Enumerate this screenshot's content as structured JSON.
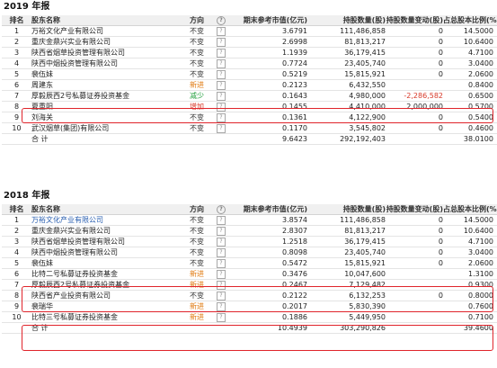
{
  "headers": {
    "rank": "排名",
    "name": "股东名称",
    "direction": "方向",
    "help_icon": "?",
    "market_value": "期末参考市值(亿元)",
    "holding": "持股数量(股)",
    "holding_change": "持股数量变动(股)",
    "pct": "占总股本比例(%)"
  },
  "report_2019": {
    "title": "2019 年报",
    "rows": [
      {
        "rank": "1",
        "name": "万裕文化产业有限公司",
        "dir": "不变",
        "dir_type": "same",
        "mv": "3.6791",
        "hold": "111,486,858",
        "chg": "0",
        "pct": "14.5000"
      },
      {
        "rank": "2",
        "name": "重庆金鼎兴实业有限公司",
        "dir": "不变",
        "dir_type": "same",
        "mv": "2.6998",
        "hold": "81,813,217",
        "chg": "0",
        "pct": "10.6400"
      },
      {
        "rank": "3",
        "name": "陕西省烟草投资管理有限公司",
        "dir": "不变",
        "dir_type": "same",
        "mv": "1.1939",
        "hold": "36,179,415",
        "chg": "0",
        "pct": "4.7100"
      },
      {
        "rank": "4",
        "name": "陕西中烟投资管理有限公司",
        "dir": "不变",
        "dir_type": "same",
        "mv": "0.7724",
        "hold": "23,405,740",
        "chg": "0",
        "pct": "3.0400"
      },
      {
        "rank": "5",
        "name": "裴伍妹",
        "dir": "不变",
        "dir_type": "same",
        "mv": "0.5219",
        "hold": "15,815,921",
        "chg": "0",
        "pct": "2.0600"
      },
      {
        "rank": "6",
        "name": "周建东",
        "dir": "新进",
        "dir_type": "new",
        "mv": "0.2123",
        "hold": "6,432,550",
        "chg": "",
        "pct": "0.8400"
      },
      {
        "rank": "7",
        "name": "厚毅辰西2号私募证券投资基金",
        "dir": "减少",
        "dir_type": "down",
        "mv": "0.1643",
        "hold": "4,980,000",
        "chg": "-2,286,582",
        "pct": "0.6500"
      },
      {
        "rank": "8",
        "name": "夏重阳",
        "dir": "增加",
        "dir_type": "up",
        "mv": "0.1455",
        "hold": "4,410,000",
        "chg": "2,000,000",
        "pct": "0.5700"
      },
      {
        "rank": "9",
        "name": "刘海关",
        "dir": "不变",
        "dir_type": "same",
        "mv": "0.1361",
        "hold": "4,122,900",
        "chg": "0",
        "pct": "0.5400"
      },
      {
        "rank": "10",
        "name": "武汉烟草(集团)有限公司",
        "dir": "不变",
        "dir_type": "same",
        "mv": "0.1170",
        "hold": "3,545,802",
        "chg": "0",
        "pct": "0.4600"
      }
    ],
    "total": {
      "label": "合 计",
      "mv": "9.6423",
      "hold": "292,192,403",
      "pct": "38.0100"
    }
  },
  "report_2018": {
    "title": "2018 年报",
    "rows": [
      {
        "rank": "1",
        "name": "万裕文化产业有限公司",
        "dir": "不变",
        "dir_type": "same",
        "mv": "3.8574",
        "hold": "111,486,858",
        "chg": "0",
        "pct": "14.5000",
        "link": true
      },
      {
        "rank": "2",
        "name": "重庆金鼎兴实业有限公司",
        "dir": "不变",
        "dir_type": "same",
        "mv": "2.8307",
        "hold": "81,813,217",
        "chg": "0",
        "pct": "10.6400"
      },
      {
        "rank": "3",
        "name": "陕西省烟草投资管理有限公司",
        "dir": "不变",
        "dir_type": "same",
        "mv": "1.2518",
        "hold": "36,179,415",
        "chg": "0",
        "pct": "4.7100"
      },
      {
        "rank": "4",
        "name": "陕西中烟投资管理有限公司",
        "dir": "不变",
        "dir_type": "same",
        "mv": "0.8098",
        "hold": "23,405,740",
        "chg": "0",
        "pct": "3.0400"
      },
      {
        "rank": "5",
        "name": "裴伍妹",
        "dir": "不变",
        "dir_type": "same",
        "mv": "0.5472",
        "hold": "15,815,921",
        "chg": "0",
        "pct": "2.0600"
      },
      {
        "rank": "6",
        "name": "比特二号私募证券投资基金",
        "dir": "新进",
        "dir_type": "new",
        "mv": "0.3476",
        "hold": "10,047,600",
        "chg": "",
        "pct": "1.3100"
      },
      {
        "rank": "7",
        "name": "厚毅辰西2号私募证券投资基金",
        "dir": "新进",
        "dir_type": "new",
        "mv": "0.2467",
        "hold": "7,129,482",
        "chg": "",
        "pct": "0.9300"
      },
      {
        "rank": "8",
        "name": "陕西省产业投资有限公司",
        "dir": "不变",
        "dir_type": "same",
        "mv": "0.2122",
        "hold": "6,132,253",
        "chg": "0",
        "pct": "0.8000"
      },
      {
        "rank": "9",
        "name": "裴瑞华",
        "dir": "新进",
        "dir_type": "new",
        "mv": "0.2017",
        "hold": "5,830,390",
        "chg": "",
        "pct": "0.7600"
      },
      {
        "rank": "10",
        "name": "比特三号私募证券投资基金",
        "dir": "新进",
        "dir_type": "new",
        "mv": "0.1886",
        "hold": "5,449,950",
        "chg": "",
        "pct": "0.7100"
      }
    ],
    "total": {
      "label": "合 计",
      "mv": "10.4939",
      "hold": "303,290,826",
      "pct": "39.4600"
    }
  }
}
